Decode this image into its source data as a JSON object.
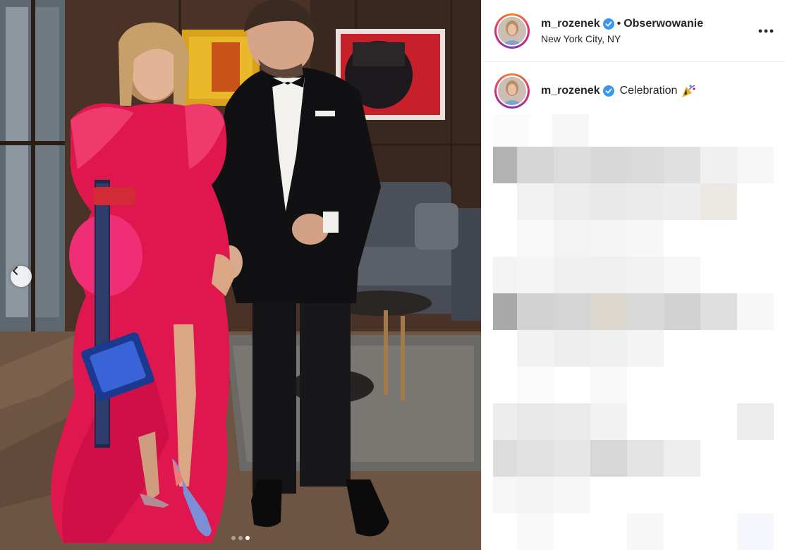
{
  "post": {
    "username": "m_rozenek",
    "separator": "•",
    "follow_label": "Obserwowanie",
    "location": "New York City, NY",
    "more_icon": "more-options-icon",
    "verified_color": "#3897f0"
  },
  "caption": {
    "username": "m_rozenek",
    "text": "Celebration",
    "emoji_icon": "party-popper-icon"
  },
  "carousel": {
    "slide_count": 3,
    "active_index": 2
  },
  "colors": {
    "dress": "#e0164f",
    "link": "#262626",
    "border": "#efefef"
  }
}
